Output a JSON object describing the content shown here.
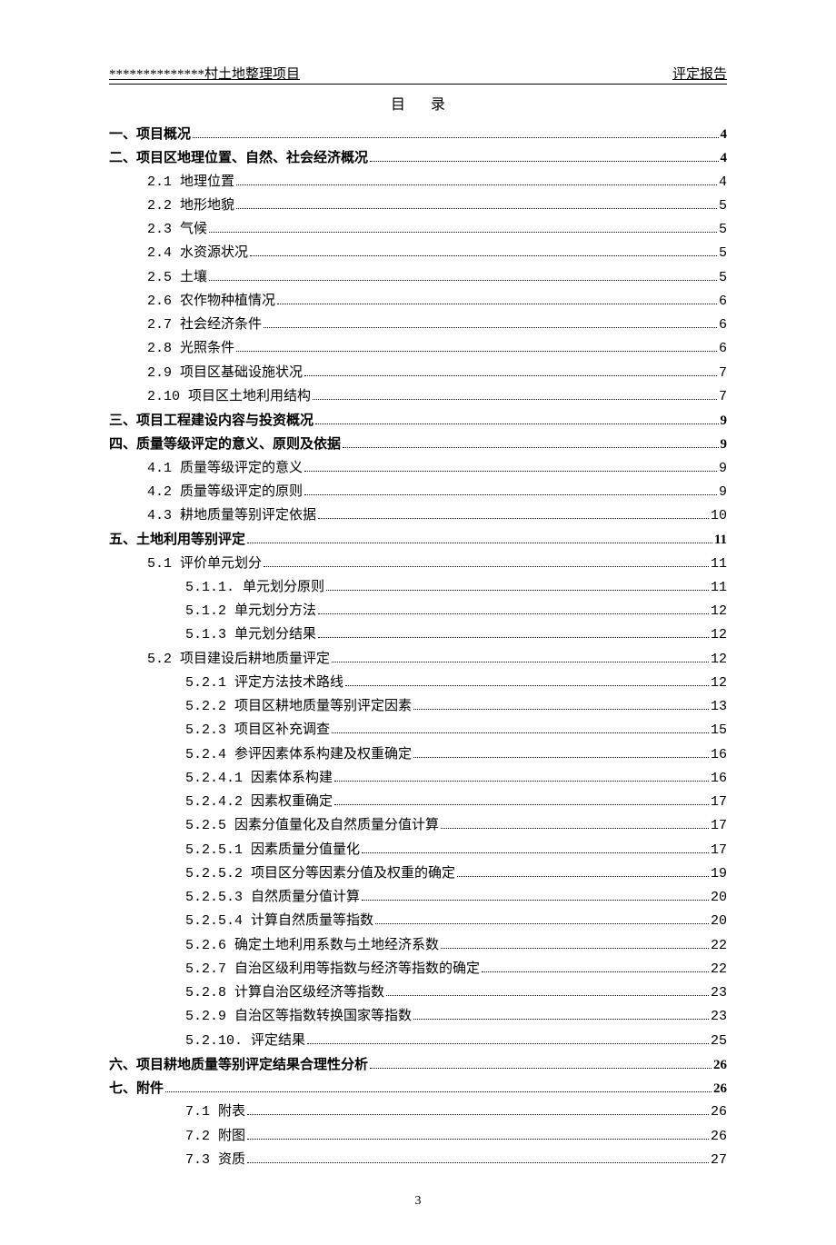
{
  "header": {
    "left": "**************村土地整理项目",
    "right": "评定报告"
  },
  "title": "目录",
  "page_number": "3",
  "toc": [
    {
      "level": 0,
      "label": "一、项目概况",
      "page": "4"
    },
    {
      "level": 0,
      "label": "二、项目区地理位置、自然、社会经济概况",
      "page": "4"
    },
    {
      "level": 1,
      "label": "2.1 地理位置",
      "page": "4"
    },
    {
      "level": 1,
      "label": "2.2 地形地貌",
      "page": "5"
    },
    {
      "level": 1,
      "label": "2.3 气候",
      "page": "5"
    },
    {
      "level": 1,
      "label": "2.4 水资源状况",
      "page": "5"
    },
    {
      "level": 1,
      "label": "2.5 土壤",
      "page": "5"
    },
    {
      "level": 1,
      "label": "2.6 农作物种植情况",
      "page": "6"
    },
    {
      "level": 1,
      "label": "2.7 社会经济条件",
      "page": "6"
    },
    {
      "level": 1,
      "label": "2.8 光照条件",
      "page": "6"
    },
    {
      "level": 1,
      "label": "2.9 项目区基础设施状况",
      "page": "7"
    },
    {
      "level": 1,
      "label": "2.10 项目区土地利用结构",
      "page": "7"
    },
    {
      "level": 0,
      "label": "三、项目工程建设内容与投资概况",
      "page": "9"
    },
    {
      "level": 0,
      "label": "四、质量等级评定的意义、原则及依据",
      "page": "9"
    },
    {
      "level": 1,
      "label": "4.1 质量等级评定的意义",
      "page": "9"
    },
    {
      "level": 1,
      "label": "4.2 质量等级评定的原则",
      "page": "9"
    },
    {
      "level": 1,
      "label": "4.3 耕地质量等别评定依据",
      "page": "10"
    },
    {
      "level": 0,
      "label": "五、土地利用等别评定",
      "page": "11"
    },
    {
      "level": 1,
      "label": "5.1 评价单元划分",
      "page": "11"
    },
    {
      "level": 2,
      "label": "5.1.1. 单元划分原则",
      "page": "11"
    },
    {
      "level": 2,
      "label": "5.1.2 单元划分方法",
      "page": "12"
    },
    {
      "level": 2,
      "label": "5.1.3 单元划分结果",
      "page": "12"
    },
    {
      "level": 1,
      "label": "5.2 项目建设后耕地质量评定",
      "page": "12"
    },
    {
      "level": 2,
      "label": "5.2.1 评定方法技术路线",
      "page": "12"
    },
    {
      "level": 2,
      "label": "5.2.2 项目区耕地质量等别评定因素",
      "page": "13"
    },
    {
      "level": 2,
      "label": "5.2.3 项目区补充调查",
      "page": "15"
    },
    {
      "level": 2,
      "label": "5.2.4 参评因素体系构建及权重确定",
      "page": "16"
    },
    {
      "level": 2,
      "label": "5.2.4.1 因素体系构建",
      "page": "16"
    },
    {
      "level": 2,
      "label": "5.2.4.2 因素权重确定",
      "page": "17"
    },
    {
      "level": 2,
      "label": "5.2.5 因素分值量化及自然质量分值计算",
      "page": "17"
    },
    {
      "level": 2,
      "label": "5.2.5.1 因素质量分值量化",
      "page": "17"
    },
    {
      "level": 2,
      "label": "5.2.5.2 项目区分等因素分值及权重的确定",
      "page": "19"
    },
    {
      "level": 2,
      "label": "5.2.5.3 自然质量分值计算",
      "page": "20"
    },
    {
      "level": 2,
      "label": "5.2.5.4 计算自然质量等指数",
      "page": "20"
    },
    {
      "level": 2,
      "label": "5.2.6 确定土地利用系数与土地经济系数",
      "page": "22"
    },
    {
      "level": 2,
      "label": "5.2.7 自治区级利用等指数与经济等指数的确定",
      "page": "22"
    },
    {
      "level": 2,
      "label": "5.2.8 计算自治区级经济等指数",
      "page": "23"
    },
    {
      "level": 2,
      "label": "5.2.9 自治区等指数转换国家等指数",
      "page": "23"
    },
    {
      "level": 2,
      "label": "5.2.10. 评定结果",
      "page": "25"
    },
    {
      "level": 0,
      "label": "六、项目耕地质量等别评定结果合理性分析",
      "page": "26"
    },
    {
      "level": 0,
      "label": "七、附件",
      "page": "26"
    },
    {
      "level": 2,
      "label": "7.1 附表",
      "page": "26"
    },
    {
      "level": 2,
      "label": "7.2 附图",
      "page": "26"
    },
    {
      "level": 2,
      "label": "7.3 资质",
      "page": "27"
    }
  ]
}
